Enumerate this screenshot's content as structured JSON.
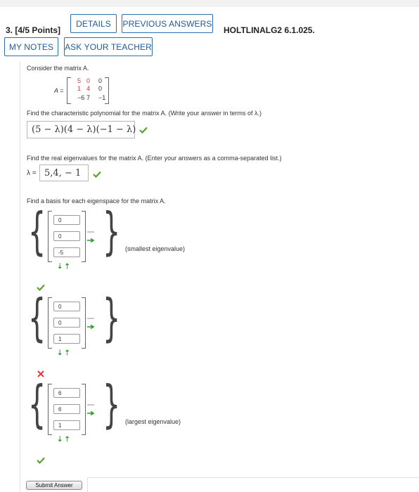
{
  "header": {
    "question_number": "3.",
    "points": "[4/5 Points]",
    "details_label": "DETAILS",
    "previous_answers_label": "PREVIOUS ANSWERS",
    "problem_code": "HOLTLINALG2 6.1.025.",
    "my_notes_label": "MY NOTES",
    "ask_teacher_label": "ASK YOUR TEACHER"
  },
  "problem": {
    "intro": "Consider the matrix A.",
    "matrix_name": "A =",
    "matrix": [
      [
        "5",
        "0",
        "0"
      ],
      [
        "1",
        "4",
        "0"
      ],
      [
        "−6",
        "7",
        "−1"
      ]
    ],
    "char_poly_prompt": "Find the characteristic polynomial for the matrix A. (Write your answer in terms of λ.)",
    "char_poly_answer": "(5 − λ)(4 − λ)(−1 − λ)",
    "eigen_prompt": "Find the real eigenvalues for the matrix A. (Enter your answers as a comma-separated list.)",
    "lambda_label": "λ =",
    "eigen_answer": "5,4, − 1",
    "basis_prompt": "Find a basis for each eigenspace for the matrix A.",
    "eigenspaces": [
      {
        "values": [
          "0",
          "0",
          "-5"
        ],
        "note": "(smallest eigenvalue)",
        "status": "correct"
      },
      {
        "values": [
          "0",
          "0",
          "1"
        ],
        "note": "",
        "status": "incorrect"
      },
      {
        "values": [
          "6",
          "6",
          "1"
        ],
        "note": "(largest eigenvalue)",
        "status": "correct"
      }
    ],
    "submit_label": "Submit Answer"
  },
  "colors": {
    "accent": "#2a6fb0",
    "correct": "#5aa02c",
    "incorrect": "#e03a3a",
    "red_entry": "#d23b3b",
    "add_arrow": "#2f9a2f"
  },
  "icons": [
    "checkmark-icon",
    "x-mark-icon",
    "arrow-down-icon",
    "arrow-up-icon",
    "add-column-icon",
    "remove-column-icon"
  ]
}
